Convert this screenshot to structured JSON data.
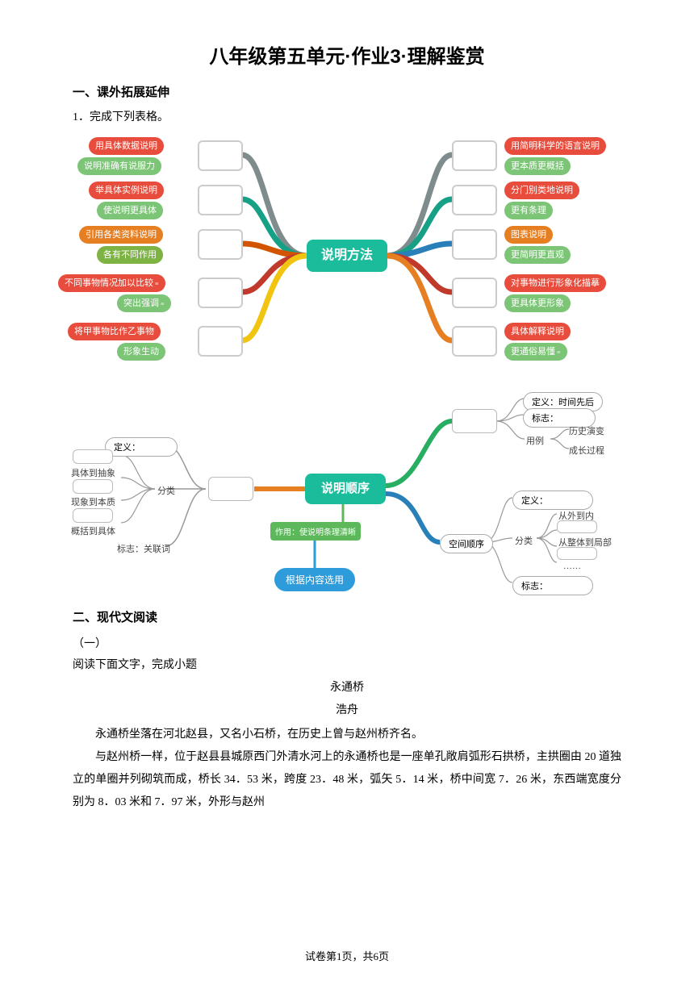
{
  "title": "八年级第五单元·作业3·理解鉴赏",
  "section1": "一、课外拓展延伸",
  "q1": "1．完成下列表格。",
  "mm1": {
    "center": "说明方法",
    "left": [
      {
        "top": "用具体数据说明",
        "bot": "说明准确有说服力",
        "tc": "#e74c3c",
        "bc": "#7cc576"
      },
      {
        "top": "举具体实例说明",
        "bot": "使说明更具体",
        "tc": "#e74c3c",
        "bc": "#7cc576"
      },
      {
        "top": "引用各类资料说明",
        "bot": "各有不同作用",
        "tc": "#e67e22",
        "bc": "#7cb342"
      },
      {
        "top": "不同事物情况加以比较",
        "bot": "突出强调",
        "tc": "#e74c3c",
        "bc": "#7cc576",
        "tag1": "≡",
        "tag2": "≡"
      },
      {
        "top": "将甲事物比作乙事物",
        "bot": "形象生动",
        "tc": "#e74c3c",
        "bc": "#7cc576"
      }
    ],
    "right": [
      {
        "top": "用简明科学的语言说明",
        "bot": "更本质更概括",
        "tc": "#e74c3c",
        "bc": "#7cc576"
      },
      {
        "top": "分门别类地说明",
        "bot": "更有条理",
        "tc": "#e74c3c",
        "bc": "#7cc576"
      },
      {
        "top": "图表说明",
        "bot": "更简明更直观",
        "tc": "#e67e22",
        "bc": "#7cc576"
      },
      {
        "top": "对事物进行形象化描摹",
        "bot": "更具体更形象",
        "tc": "#e74c3c",
        "bc": "#7cc576"
      },
      {
        "top": "具体解释说明",
        "bot": "更通俗易懂",
        "tc": "#e74c3c",
        "bc": "#7cc576",
        "tag2": "≡"
      }
    ]
  },
  "mm2": {
    "center": "说明顺序",
    "left": {
      "def": "定义：",
      "cat": "分类",
      "items": [
        "具体到抽象",
        "现象到本质",
        "概括到具体"
      ],
      "mark": "标志：关联词"
    },
    "action": "作用：使说明条理清晰",
    "blue": "根据内容选用",
    "r1": {
      "def": "定义：时间先后",
      "mark": "标志：",
      "use": "用例",
      "u1": "历史演变",
      "u2": "成长过程"
    },
    "r2": {
      "node": "空间顺序",
      "def": "定义：",
      "cat": "分类",
      "c1": "从外到内",
      "c2": "从整体到局部",
      "c3": "……",
      "mark": "标志："
    }
  },
  "section2": "二、现代文阅读",
  "sub1": "（一）",
  "lead": "阅读下面文字，完成小题",
  "art_title": "永通桥",
  "author": "浩舟",
  "p1": "永通桥坐落在河北赵县，又名小石桥，在历史上曾与赵州桥齐名。",
  "p2": "与赵州桥一样，位于赵县县城原西门外清水河上的永通桥也是一座单孔敞肩弧形石拱桥，主拱圈由 20 道独立的单圈并列砌筑而成，桥长 34．53 米，跨度 23．48 米，弧矢 5．14 米，桥中间宽 7．26 米，东西端宽度分别为 8．03 米和 7．97 米，外形与赵州",
  "footer": "试卷第1页，共6页"
}
